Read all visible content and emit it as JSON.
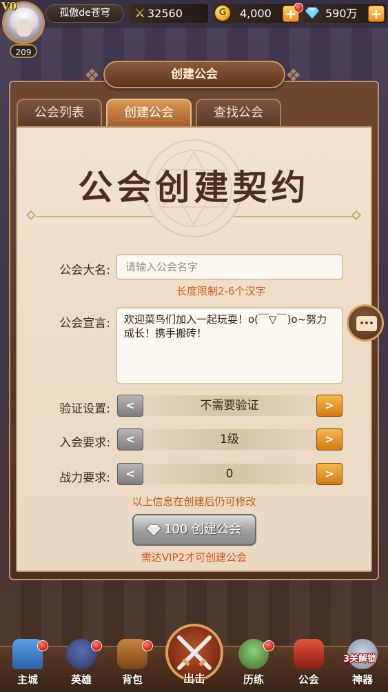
{
  "player": {
    "vip_label": "V0",
    "name": "孤傲de苍穹",
    "level": "209",
    "power": "32560",
    "gold": "4,000",
    "gems": "590万"
  },
  "header": {
    "title": "创建公会"
  },
  "tabs": [
    {
      "label": "公会列表",
      "active": false
    },
    {
      "label": "创建公会",
      "active": true
    },
    {
      "label": "查找公会",
      "active": false
    }
  ],
  "contract": {
    "title": "公会创建契约",
    "name_label": "公会大名:",
    "name_placeholder": "请输入公会名字",
    "name_hint": "长度限制2-6个汉字",
    "motto_label": "公会宣言:",
    "motto_text": "欢迎菜鸟们加入一起玩耍！o(￣▽￣)o~努力成长！携手搬砖！"
  },
  "settings": [
    {
      "label": "验证设置:",
      "value": "不需要验证",
      "prev": "<",
      "next": ">"
    },
    {
      "label": "入会要求:",
      "value": "1级",
      "prev": "<",
      "next": ">"
    },
    {
      "label": "战力要求:",
      "value": "0",
      "prev": "<",
      "next": ">"
    }
  ],
  "note": "以上信息在创建后仍可修改",
  "create_button": {
    "label": "100 创建公会"
  },
  "vip_requirement": "需达VIP2才可创建公会",
  "nav": [
    {
      "label": "主城",
      "icon": "castle-icon"
    },
    {
      "label": "英雄",
      "icon": "hero-helmet-icon"
    },
    {
      "label": "背包",
      "icon": "backpack-icon"
    },
    {
      "label": "出击",
      "icon": "crossed-swords-icon"
    },
    {
      "label": "历练",
      "icon": "training-icon"
    },
    {
      "label": "公会",
      "icon": "guild-banner-icon"
    },
    {
      "label": "神器",
      "icon": "artifact-icon"
    }
  ],
  "unlock_tag": "3关解锁",
  "colors": {
    "accent_orange": "#c8641c",
    "vip_warning": "#e04a1e",
    "parchment": "#ecdcc5"
  }
}
